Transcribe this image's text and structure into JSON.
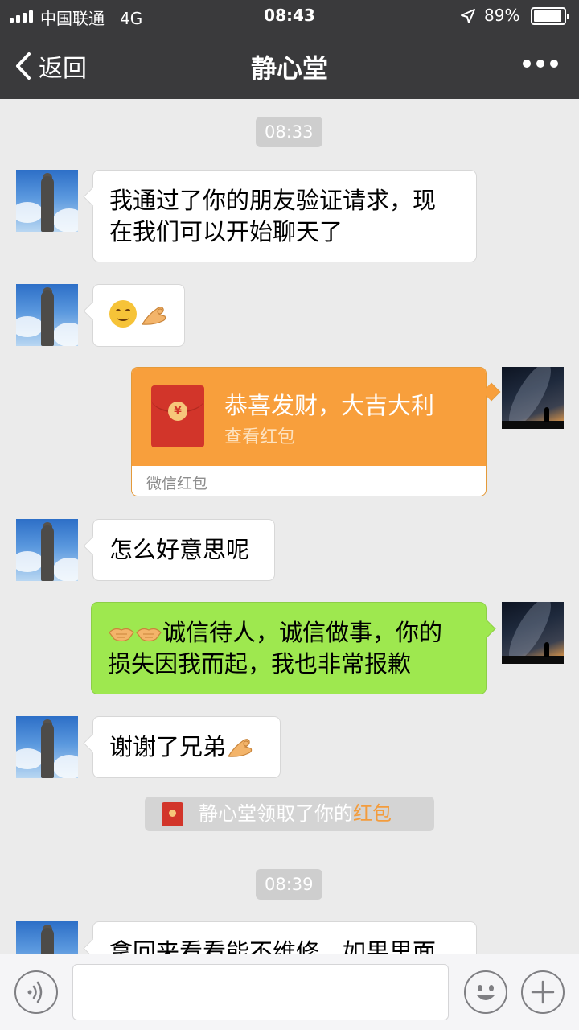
{
  "status_bar": {
    "carrier": "中国联通",
    "network": "4G",
    "time": "08:43",
    "battery_percent": "89%",
    "battery_level": 0.89
  },
  "nav": {
    "back_label": "返回",
    "title": "静心堂"
  },
  "chat": {
    "time_1": "08:33",
    "msg_1_line1": "我通过了你的朋友验证请求，现",
    "msg_1_line2": "在我们可以开始聊天了",
    "msg_2_emojis": [
      "smiling-face",
      "ok-hand"
    ],
    "red_packet": {
      "title": "恭喜发财，大吉大利",
      "subtitle": "查看红包",
      "footer": "微信红包",
      "coin_symbol": "¥"
    },
    "msg_4": "怎么好意思呢",
    "msg_5_line1": "诚信待人，诚信做事，你的",
    "msg_5_line2": "损失因我而起，我也非常报歉",
    "msg_5_emojis": [
      "handshake",
      "handshake"
    ],
    "msg_6": "谢谢了兄弟",
    "notice_text": "静心堂领取了你的",
    "notice_link": "红包",
    "time_2": "08:39",
    "msg_7_partial": "拿回来看看能不维修，如果里面"
  },
  "input_bar": {
    "left_icon": "voice-icon",
    "emoji_icon": "emoji-icon",
    "plus_icon": "plus-icon"
  },
  "colors": {
    "nav_bg": "#3a3a3c",
    "chat_bg": "#ebebeb",
    "sent_bubble": "#9ee84f",
    "red_packet": "#f89f3c",
    "accent_orange": "#f39c3d"
  }
}
